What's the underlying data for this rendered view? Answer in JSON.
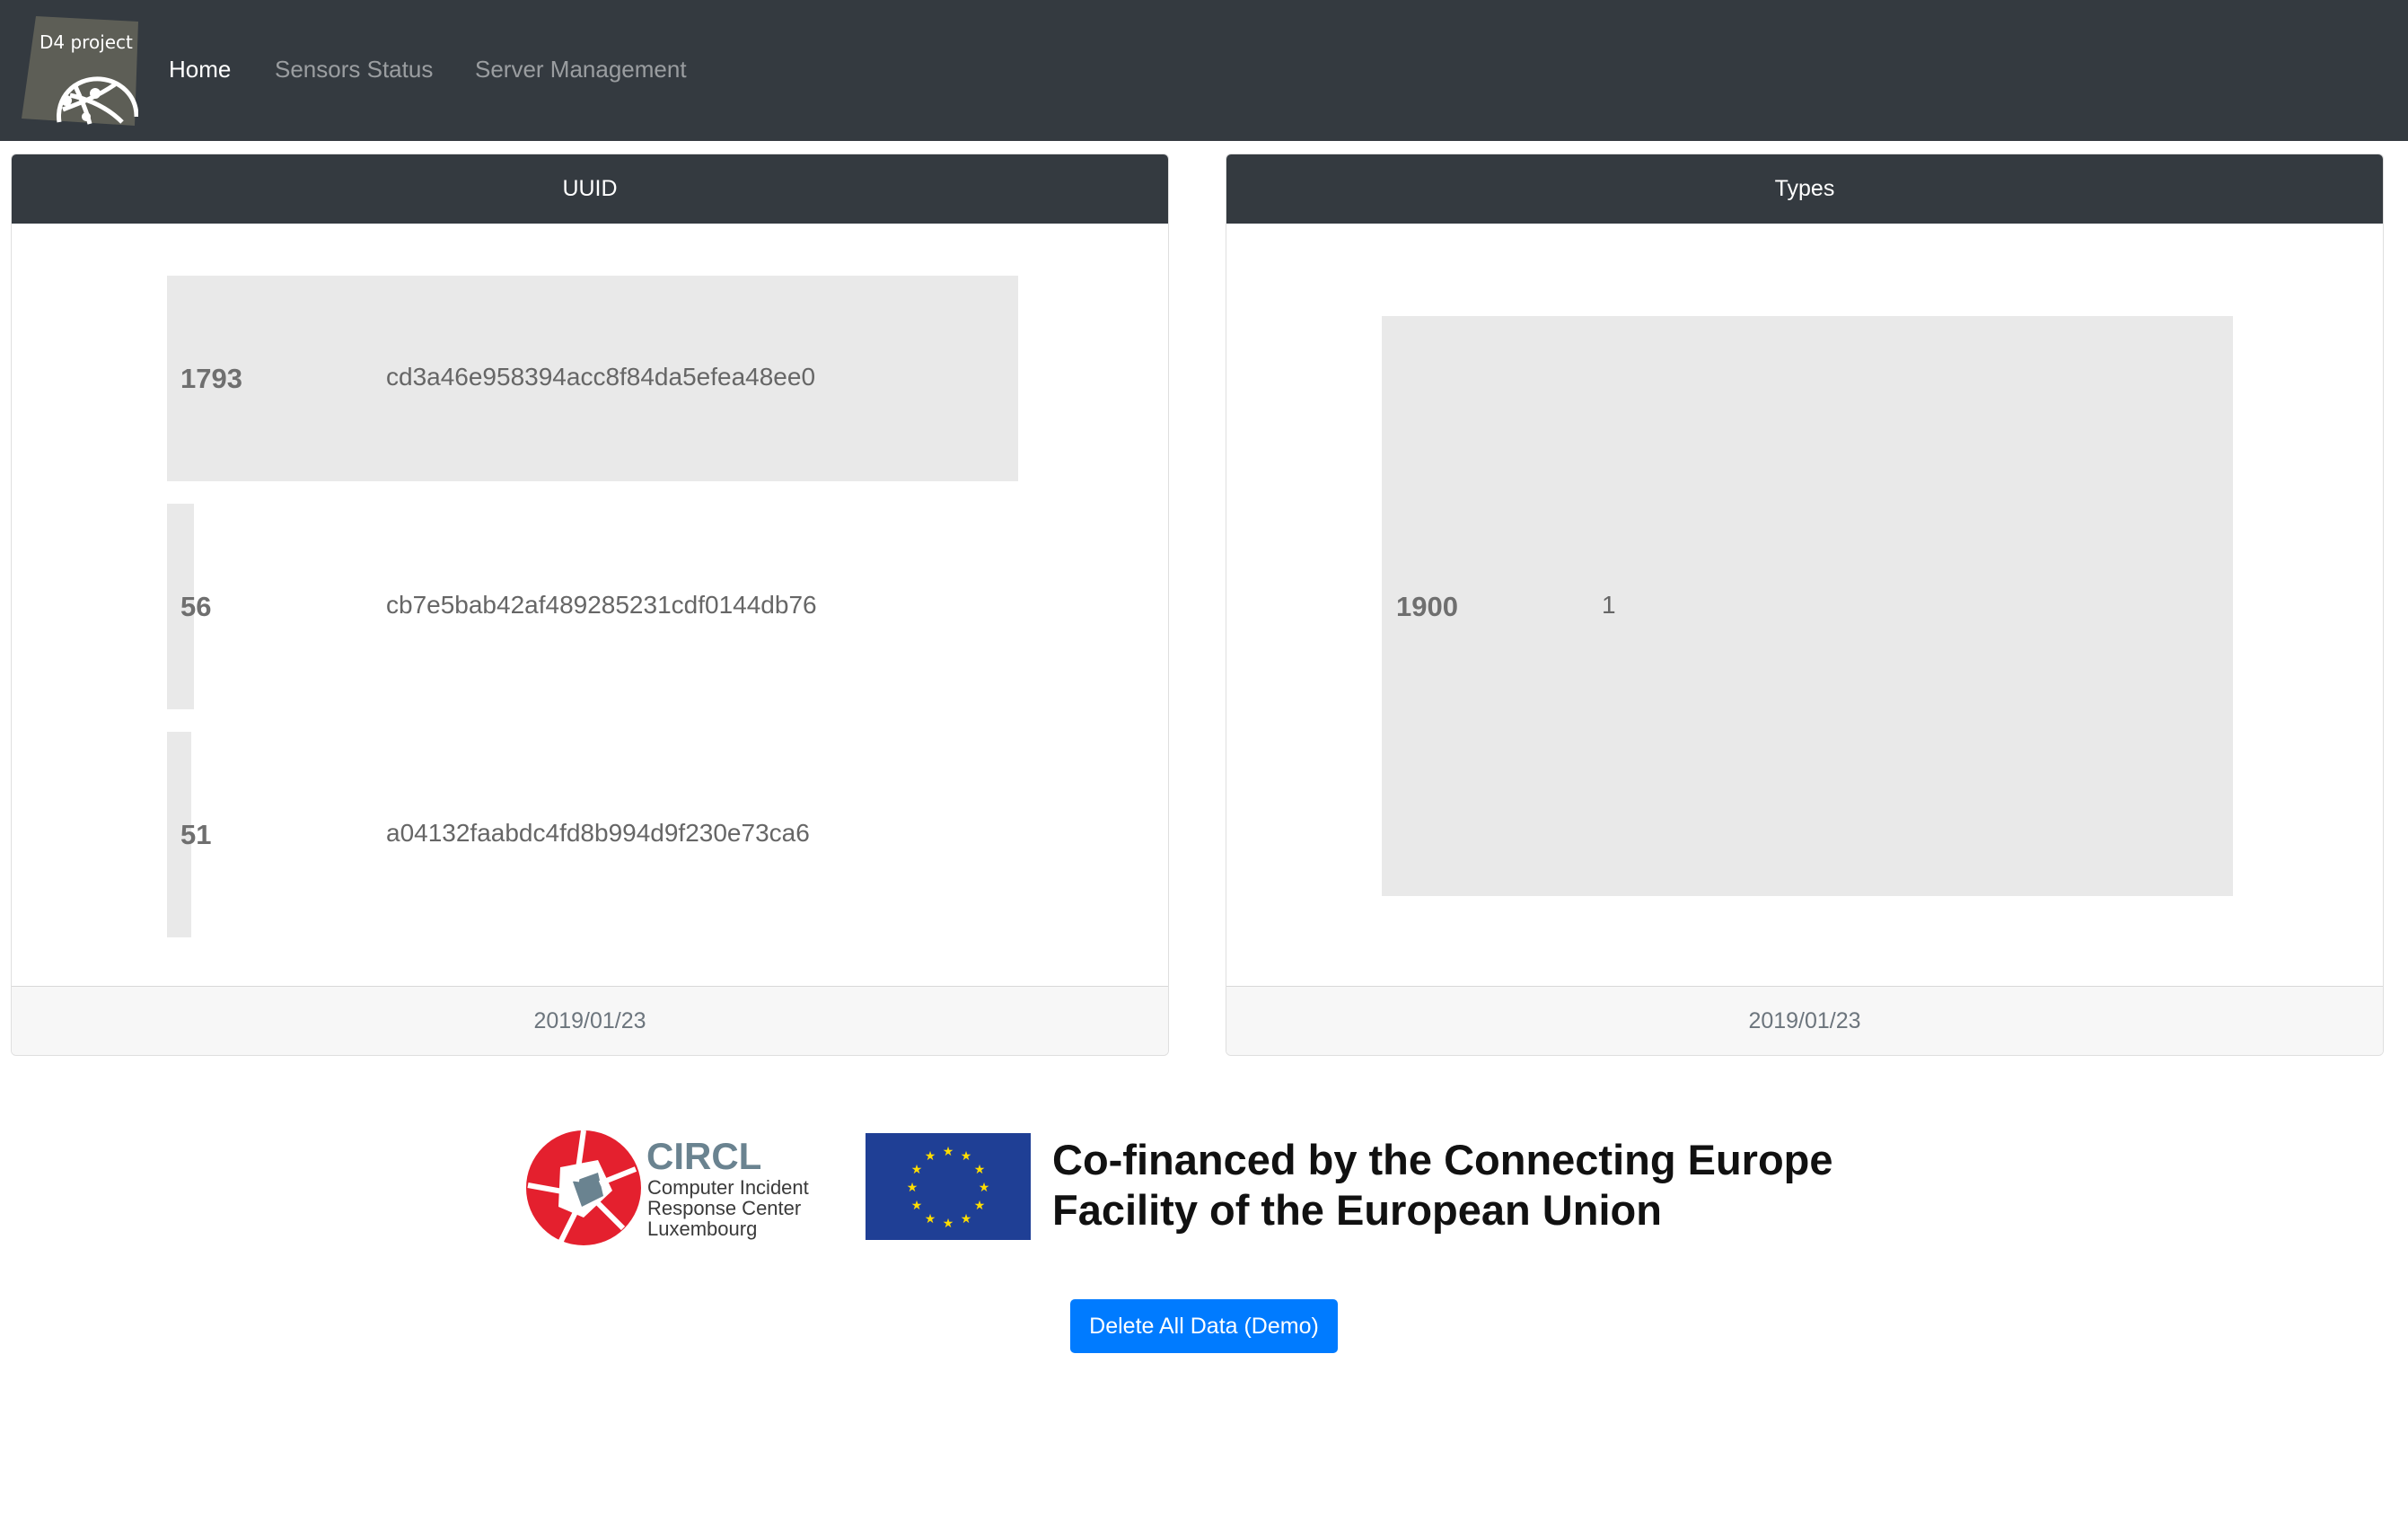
{
  "navbar": {
    "brand_text": "D4 project",
    "links": [
      "Home",
      "Sensors Status",
      "Server Management"
    ]
  },
  "uuid_card": {
    "title": "UUID",
    "rows": [
      {
        "count": "1793",
        "label": "cd3a46e958394acc8f84da5efea48ee0",
        "fraction": 1.0
      },
      {
        "count": "56",
        "label": "cb7e5bab42af489285231cdf0144db76",
        "fraction": 0.031
      },
      {
        "count": "51",
        "label": "a04132faabdc4fd8b994d9f230e73ca6",
        "fraction": 0.028
      }
    ],
    "footer": "2019/01/23"
  },
  "types_card": {
    "title": "Types",
    "rows": [
      {
        "count": "1900",
        "label": "1",
        "fraction": 1.0
      }
    ],
    "footer": "2019/01/23"
  },
  "logos": {
    "circl_name": "CIRCL",
    "circl_lines": [
      "Computer Incident",
      "Response Center",
      "Luxembourg"
    ],
    "eu_text_lines": [
      "Co-financed by the Connecting Europe",
      "Facility of the European Union"
    ]
  },
  "actions": {
    "delete_label": "Delete All Data (Demo)"
  },
  "colors": {
    "navbar_bg": "#343a40",
    "bar_fill": "#e9e9e9",
    "primary_button": "#007bff",
    "eu_flag_blue": "#1f3f95",
    "eu_star_yellow": "#ffdd00",
    "circl_red": "#e4202e",
    "circl_slate": "#6a8390"
  }
}
